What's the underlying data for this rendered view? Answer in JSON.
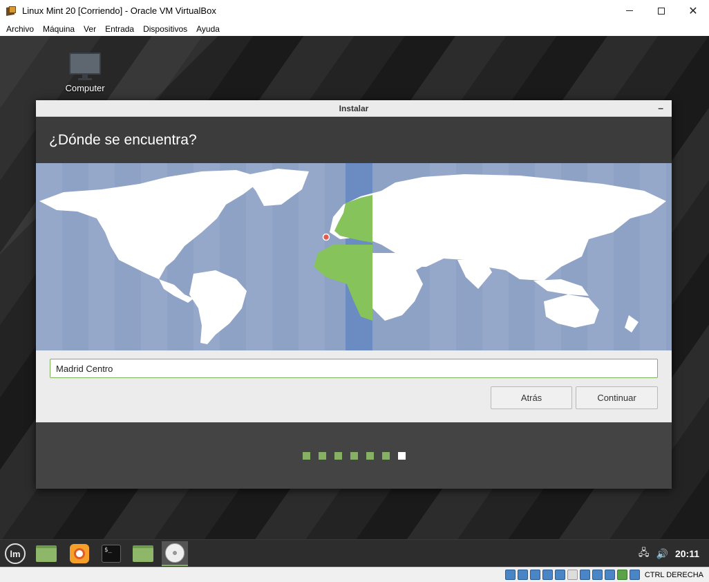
{
  "window": {
    "title": "Linux Mint 20 [Corriendo] - Oracle VM VirtualBox",
    "minimize": "—",
    "maximize": "☐",
    "close": "✕"
  },
  "menubar": {
    "items": [
      "Archivo",
      "Máquina",
      "Ver",
      "Entrada",
      "Dispositivos",
      "Ayuda"
    ]
  },
  "desktop": {
    "icon_label": "Computer"
  },
  "installer": {
    "title": "Instalar",
    "minimize": "–",
    "heading": "¿Dónde se encuentra?",
    "timezone_value": "Madrid Centro",
    "back_label": "Atrás",
    "continue_label": "Continuar",
    "progress": {
      "total_steps": 7,
      "current_step": 7
    }
  },
  "taskbar": {
    "clock": "20:11",
    "terminal_glyph": "$_",
    "mint_glyph": "lm"
  },
  "statusbar": {
    "host_key": "CTRL DERECHA"
  },
  "colors": {
    "ocean": "#8ea2c6",
    "land": "#ffffff",
    "highlight_zone": "#6b8cc2",
    "selected_region": "#86c35a",
    "accent": "#86b063"
  }
}
